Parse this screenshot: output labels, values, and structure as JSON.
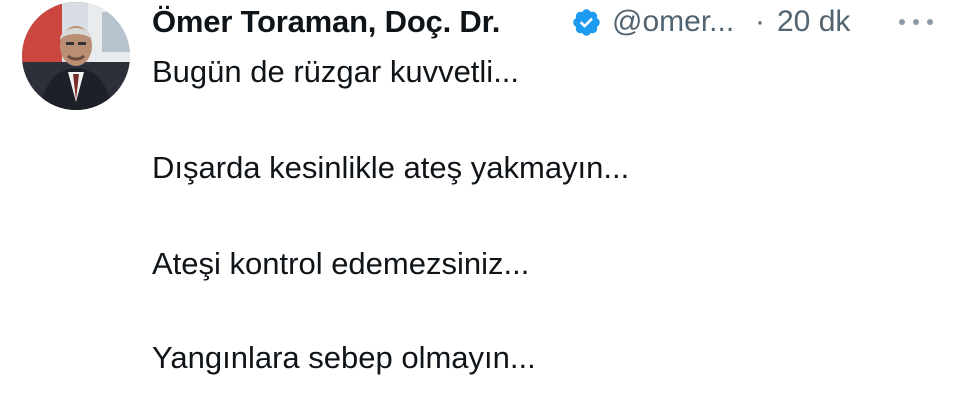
{
  "tweet": {
    "author": {
      "display_name": "Ömer Toraman, Doç. Dr.",
      "handle": "@omer...",
      "verified_icon": "verified-badge-icon",
      "avatar": "profile-photo"
    },
    "separator": "·",
    "time_ago": "20 dk",
    "more_icon": "more-options-icon",
    "lines": [
      "Bugün de rüzgar kuvvetli...",
      "Dışarda kesinlikle ateş yakmayın...",
      "Ateşi kontrol edemezsiniz...",
      "Yangınlara sebep olmayın..."
    ]
  },
  "colors": {
    "text_primary": "#0f1419",
    "text_secondary": "#536471",
    "verified_blue": "#1d9bf0"
  }
}
